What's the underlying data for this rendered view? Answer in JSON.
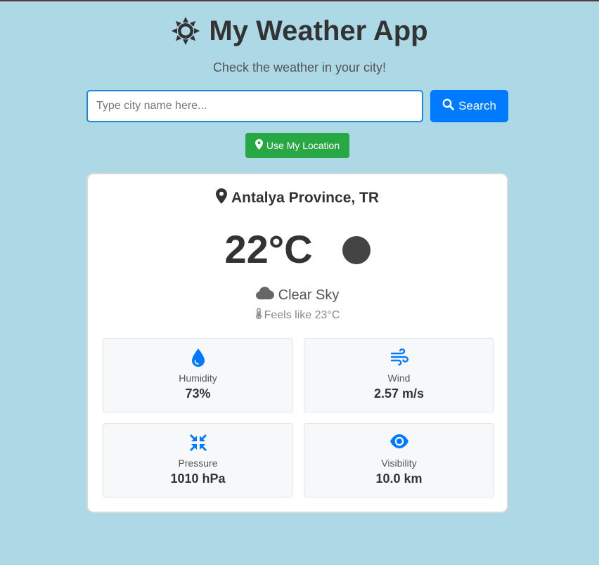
{
  "header": {
    "title": "My Weather App",
    "subtitle": "Check the weather in your city!",
    "icon": "sun-icon"
  },
  "search": {
    "placeholder": "Type city name here...",
    "value": "",
    "button_label": "Search"
  },
  "location_button_label": "Use My Location",
  "weather": {
    "city": "Antalya Province, TR",
    "temperature": "22°C",
    "description": "Clear Sky",
    "feels_like": "Feels like 23°C",
    "details": [
      {
        "label": "Humidity",
        "value": "73%",
        "icon": "droplet-icon"
      },
      {
        "label": "Wind",
        "value": "2.57 m/s",
        "icon": "wind-icon"
      },
      {
        "label": "Pressure",
        "value": "1010 hPa",
        "icon": "compress-icon"
      },
      {
        "label": "Visibility",
        "value": "10.0 km",
        "icon": "eye-icon"
      }
    ]
  },
  "colors": {
    "background": "#add8e6",
    "primary": "#007bff",
    "success": "#28a745",
    "text": "#333333"
  }
}
